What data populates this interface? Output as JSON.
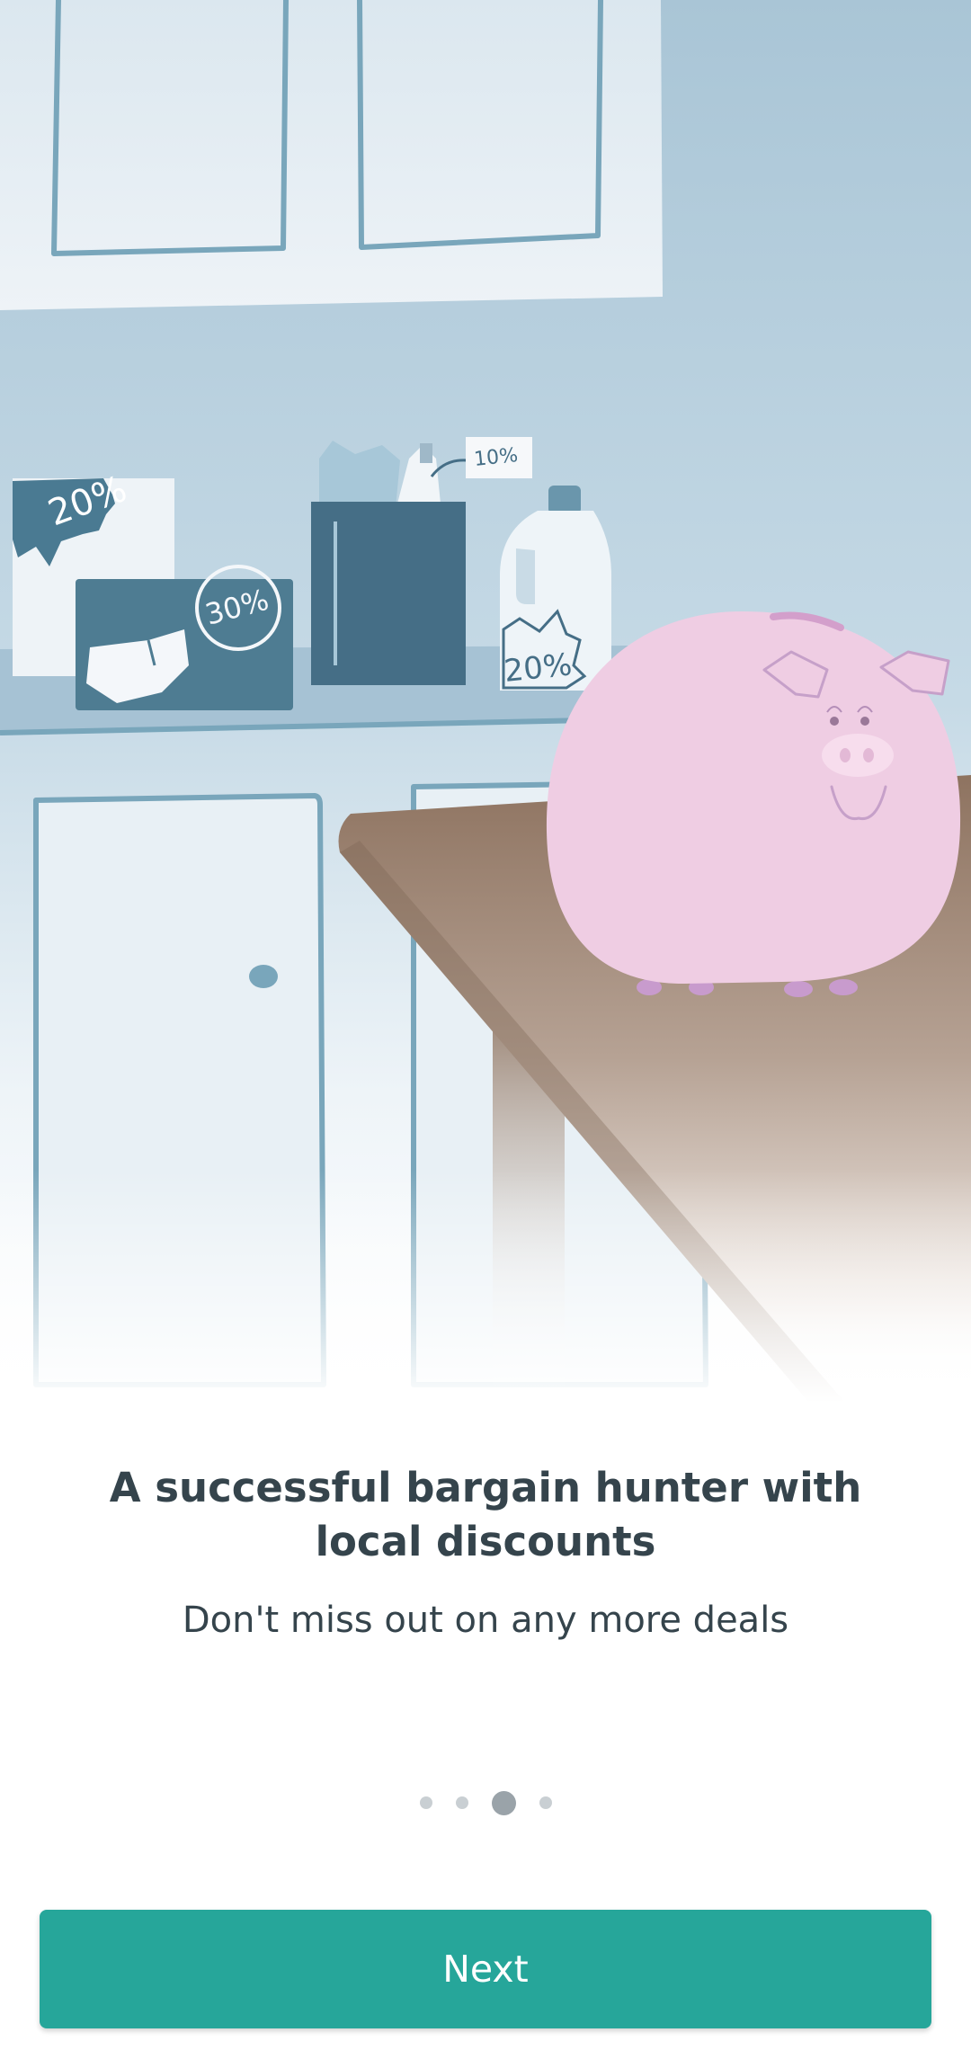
{
  "onboarding": {
    "illustration_name": "piggy-bank-kitchen",
    "badges": {
      "left_sign": "20%",
      "diaper_pack": "30%",
      "bottle_tag": "10%",
      "jug_sticker": "20%"
    },
    "headline": "A successful bargain hunter with local discounts",
    "subtitle": "Don't miss out on any more deals",
    "pager": {
      "page_count": 4,
      "current_page": 3
    },
    "next_label": "Next"
  },
  "colors": {
    "accent": "#26a69a",
    "text": "#35444c",
    "dot_inactive": "#c9cfd3",
    "dot_active": "#9aa3a9",
    "pig": "#efcde3"
  }
}
